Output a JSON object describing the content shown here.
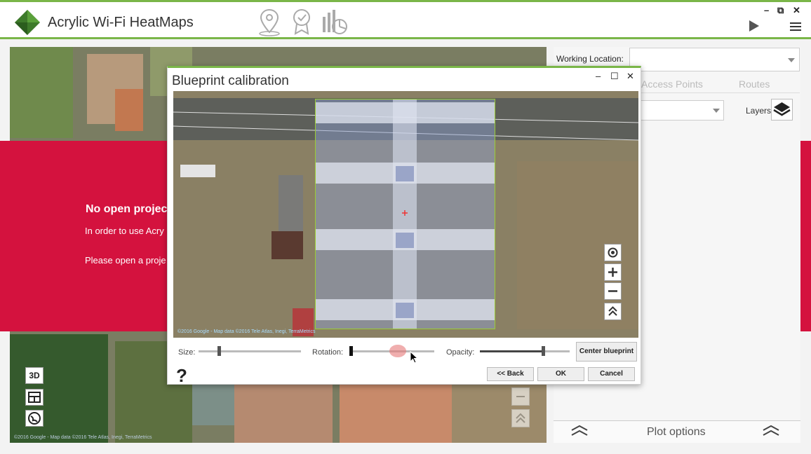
{
  "app": {
    "title": "Acrylic Wi-Fi HeatMaps",
    "colors": {
      "accent": "#7ab648",
      "banner": "#d4123e"
    },
    "toolbar_icons": [
      "location-pin-icon",
      "certificate-icon",
      "report-chart-icon"
    ],
    "window_controls": {
      "minimize": "–",
      "restore": "⧉",
      "close": "✕"
    }
  },
  "main_banner": {
    "title": "No open projec",
    "line1": "In order to use Acry",
    "line2": "Please open a proje"
  },
  "map_side_buttons": {
    "view3d": "3D"
  },
  "map_attribution": "©2016 Google - Map data ©2016 Tele Atlas, Inegi, TerraMetrics",
  "right_panel": {
    "working_location_label": "Working Location:",
    "working_location_value": "",
    "tabs": [
      "Access Points",
      "Routes"
    ],
    "layers_label": "Layers",
    "plot_options_label": "Plot options"
  },
  "dialog": {
    "title": "Blueprint calibration",
    "controls": {
      "minimize": "–",
      "maximize": "☐",
      "close": "✕"
    },
    "map_attribution": "©2016 Google - Map data ©2016 Tele Atlas, Inegi, TerraMetrics",
    "size_label": "Size:",
    "rotation_label": "Rotation:",
    "opacity_label": "Opacity:",
    "size_value": 0.2,
    "rotation_value": 0.57,
    "opacity_value": 0.7,
    "center_blueprint_label": "Center blueprint",
    "help_label": "?",
    "back_label": "<< Back",
    "ok_label": "OK",
    "cancel_label": "Cancel"
  }
}
